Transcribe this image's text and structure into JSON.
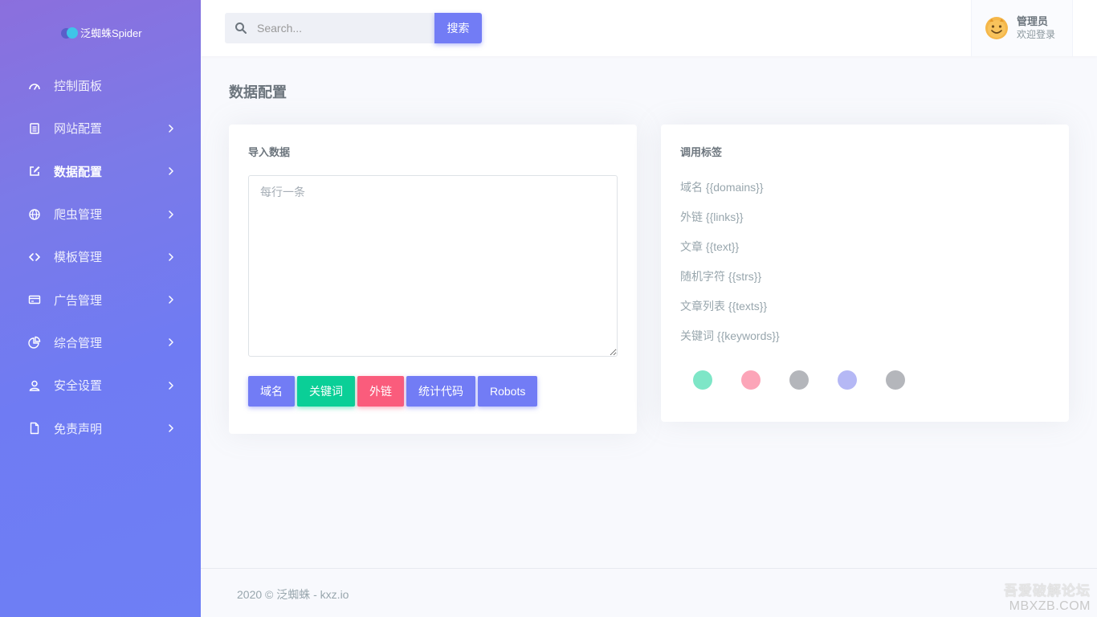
{
  "brand": {
    "name": "泛蜘蛛Spider"
  },
  "sidebar": {
    "items": [
      {
        "label": "控制面板",
        "icon": "dashboard-icon",
        "has_children": false,
        "active": false
      },
      {
        "label": "网站配置",
        "icon": "document-icon",
        "has_children": true,
        "active": false
      },
      {
        "label": "数据配置",
        "icon": "edit-icon",
        "has_children": true,
        "active": true
      },
      {
        "label": "爬虫管理",
        "icon": "globe-icon",
        "has_children": true,
        "active": false
      },
      {
        "label": "模板管理",
        "icon": "code-icon",
        "has_children": true,
        "active": false
      },
      {
        "label": "广告管理",
        "icon": "card-icon",
        "has_children": true,
        "active": false
      },
      {
        "label": "综合管理",
        "icon": "pie-chart-icon",
        "has_children": true,
        "active": false
      },
      {
        "label": "安全设置",
        "icon": "user-icon",
        "has_children": true,
        "active": false
      },
      {
        "label": "免责声明",
        "icon": "file-icon",
        "has_children": true,
        "active": false
      }
    ]
  },
  "header": {
    "search": {
      "placeholder": "Search...",
      "button_label": "搜索"
    },
    "user": {
      "name": "管理员",
      "subtitle": "欢迎登录"
    }
  },
  "page": {
    "title": "数据配置"
  },
  "import_card": {
    "title": "导入数据",
    "textarea_placeholder": "每行一条",
    "buttons": [
      {
        "label": "域名",
        "variant": "primary"
      },
      {
        "label": "关键词",
        "variant": "success"
      },
      {
        "label": "外链",
        "variant": "danger"
      },
      {
        "label": "统计代码",
        "variant": "primary"
      },
      {
        "label": "Robots",
        "variant": "primary"
      }
    ]
  },
  "tags_card": {
    "title": "调用标签",
    "tags": [
      "域名 {{domains}}",
      "外链 {{links}}",
      "文章 {{text}}",
      "随机字符 {{strs}}",
      "文章列表 {{texts}}",
      "关键词 {{keywords}}"
    ],
    "color_dots": [
      "#7ee6c7",
      "#fca5b8",
      "#b4b6bb",
      "#b5b8f5",
      "#b4b6bb"
    ]
  },
  "footer": {
    "text": "2020 © 泛蜘蛛 - kxz.io"
  },
  "watermark": {
    "line1": "吾爱破解论坛",
    "line2": "MBXZB.COM"
  },
  "colors": {
    "primary": "#727cf5",
    "success": "#0acf97",
    "danger": "#fa5c7c"
  }
}
